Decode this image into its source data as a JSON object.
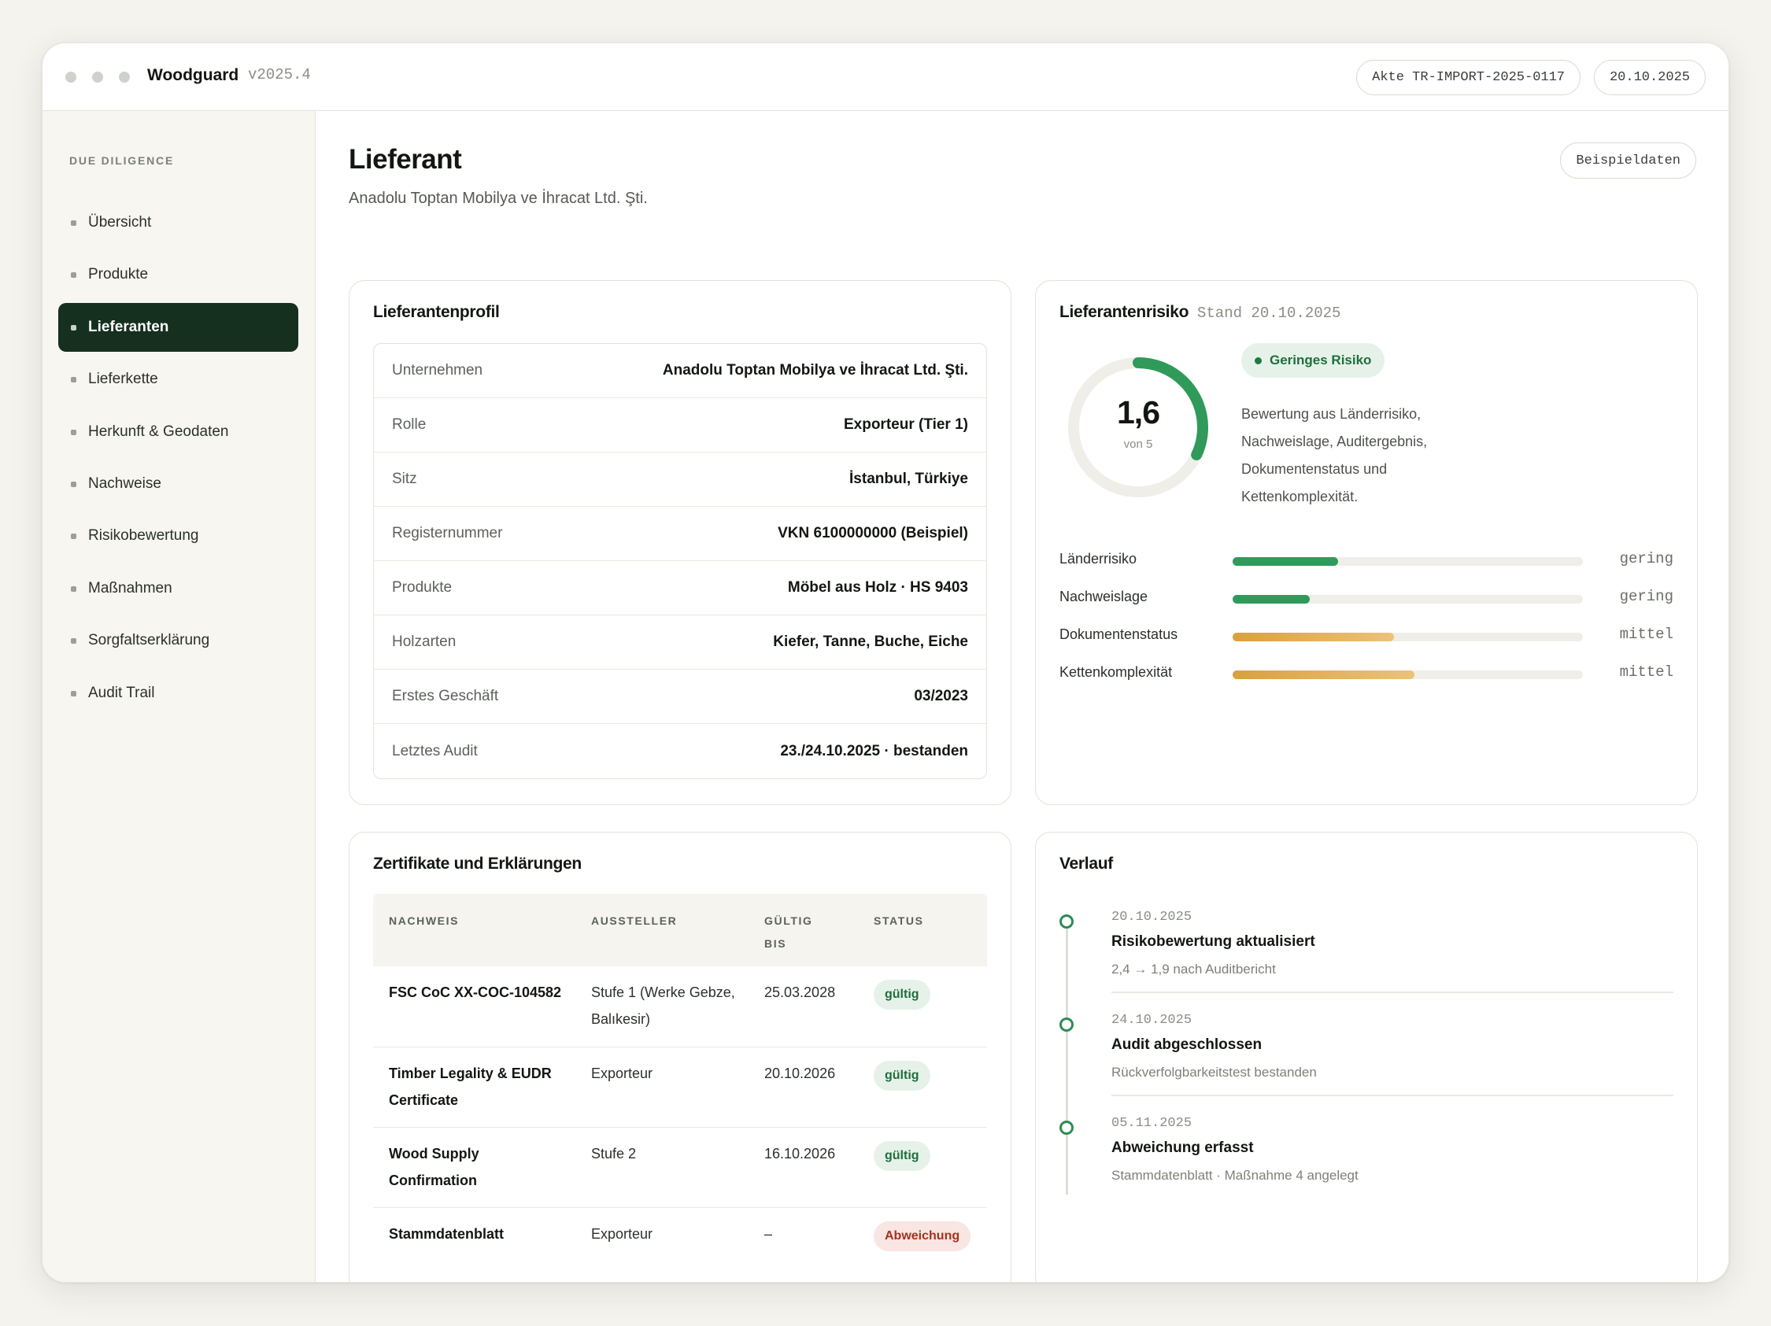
{
  "app": {
    "brand": "Woodguard",
    "version": "v2025.4",
    "file_pill": "Akte TR-IMPORT-2025-0117",
    "date_pill": "20.10.2025"
  },
  "sidebar": {
    "heading": "DUE DILIGENCE",
    "items": [
      {
        "label": "Übersicht"
      },
      {
        "label": "Produkte"
      },
      {
        "label": "Lieferanten"
      },
      {
        "label": "Lieferkette"
      },
      {
        "label": "Herkunft & Geodaten"
      },
      {
        "label": "Nachweise"
      },
      {
        "label": "Risikobewertung"
      },
      {
        "label": "Maßnahmen"
      },
      {
        "label": "Sorgfaltserklärung"
      },
      {
        "label": "Audit Trail"
      }
    ],
    "active_index": 2
  },
  "page": {
    "title": "Lieferant",
    "subtitle": "Anadolu Toptan Mobilya ve İhracat Ltd. Şti.",
    "sample_button": "Beispieldaten"
  },
  "profile": {
    "title": "Lieferantenprofil",
    "rows": [
      {
        "key": "Unternehmen",
        "value": "Anadolu Toptan Mobilya ve İhracat Ltd. Şti."
      },
      {
        "key": "Rolle",
        "value": "Exporteur (Tier 1)"
      },
      {
        "key": "Sitz",
        "value": "İstanbul, Türkiye"
      },
      {
        "key": "Registernummer",
        "value": "VKN 6100000000 (Beispiel)"
      },
      {
        "key": "Produkte",
        "value": "Möbel aus Holz · HS 9403"
      },
      {
        "key": "Holzarten",
        "value": "Kiefer, Tanne, Buche, Eiche"
      },
      {
        "key": "Erstes Geschäft",
        "value": "03/2023"
      },
      {
        "key": "Letztes Audit",
        "value": "23./24.10.2025 · bestanden"
      }
    ]
  },
  "risk": {
    "title": "Lieferantenrisiko",
    "stand": "Stand 20.10.2025",
    "score_label": "1,6",
    "score": 1.6,
    "max_label": "von 5",
    "max": 5,
    "badge": "Geringes Risiko",
    "description": "Bewertung aus Länderrisiko, Nachweislage, Auditergebnis, Dokumentenstatus und Kettenkomplexität.",
    "colors": {
      "green": "#2f9a5a",
      "amber": "#e0a84a",
      "track": "#efeee9"
    },
    "factors": [
      {
        "label": "Länderrisiko",
        "level": "gering",
        "fraction": 0.3,
        "color": "green"
      },
      {
        "label": "Nachweislage",
        "level": "gering",
        "fraction": 0.22,
        "color": "green"
      },
      {
        "label": "Dokumentenstatus",
        "level": "mittel",
        "fraction": 0.46,
        "color": "amber"
      },
      {
        "label": "Kettenkomplexität",
        "level": "mittel",
        "fraction": 0.52,
        "color": "amber"
      }
    ]
  },
  "certificates": {
    "title": "Zertifikate und Erklärungen",
    "columns": [
      "NACHWEIS",
      "AUSSTELLER",
      "GÜLTIG BIS",
      "STATUS"
    ],
    "rows": [
      {
        "name": "FSC CoC XX-COC-104582",
        "issuer": "Stufe 1 (Werke Gebze, Balıkesir)",
        "valid": "25.03.2028",
        "status": "gültig",
        "kind": "ok"
      },
      {
        "name": "Timber Legality & EUDR Certificate",
        "issuer": "Exporteur",
        "valid": "20.10.2026",
        "status": "gültig",
        "kind": "ok"
      },
      {
        "name": "Wood Supply Confirmation",
        "issuer": "Stufe 2",
        "valid": "16.10.2026",
        "status": "gültig",
        "kind": "ok"
      },
      {
        "name": "Stammdatenblatt",
        "issuer": "Exporteur",
        "valid": "–",
        "status": "Abweichung",
        "kind": "dev"
      }
    ]
  },
  "history": {
    "title": "Verlauf",
    "items": [
      {
        "date": "20.10.2025",
        "title": "Risikobewertung aktualisiert",
        "sub": "2,4 → 1,9 nach Auditbericht"
      },
      {
        "date": "24.10.2025",
        "title": "Audit abgeschlossen",
        "sub": "Rückverfolgbarkeitstest bestanden"
      },
      {
        "date": "05.11.2025",
        "title": "Abweichung erfasst",
        "sub": "Stammdatenblatt · Maßnahme 4 angelegt"
      }
    ]
  }
}
